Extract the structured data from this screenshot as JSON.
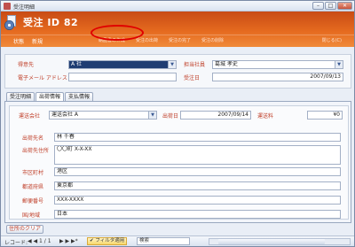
{
  "window": {
    "title": "受注明細"
  },
  "header": {
    "title": "受注 ID 82",
    "status_label": "状態",
    "status_value": "新規",
    "actions": [
      "納品書の作成",
      "受注の出荷",
      "受注の完了",
      "受注の削除"
    ],
    "close_label": "閉じる(C)"
  },
  "order": {
    "customer_label": "得意先",
    "customer_value": "A 社",
    "email_label": "電子メール アドレス",
    "email_value": "",
    "salesperson_label": "担当社員",
    "salesperson_value": "葛城 孝史",
    "order_date_label": "受注日",
    "order_date_value": "2007/09/13"
  },
  "tabs": [
    "受注明細",
    "出荷情報",
    "支払情報"
  ],
  "shipping": {
    "carrier_label": "運送会社",
    "carrier_value": "運送会社 A",
    "ship_date_label": "出荷日",
    "ship_date_value": "2007/09/14",
    "fee_label": "運送料",
    "fee_value": "¥0",
    "name_label": "出荷先名",
    "name_value": "林 千春",
    "address_label": "出荷先住所",
    "address_value": "〇〇町 X-X-XX",
    "city_label": "市区町村",
    "city_value": "港区",
    "pref_label": "都道府県",
    "pref_value": "東京都",
    "zip_label": "郵便番号",
    "zip_value": "XXX-XXXX",
    "country_label": "国/地域",
    "country_value": "日本"
  },
  "clear_address_label": "住所のクリア",
  "statusbar": {
    "record_label": "レコード:",
    "record_nav": "◀ ◀ 1 / 1",
    "nav_next": "▶ ▶ ▶*",
    "filter_label": "フィルタ適用",
    "search_label": "検索"
  },
  "colors": {
    "header": "#e56a1f",
    "label": "#c0402a",
    "highlight": "#e00000"
  }
}
